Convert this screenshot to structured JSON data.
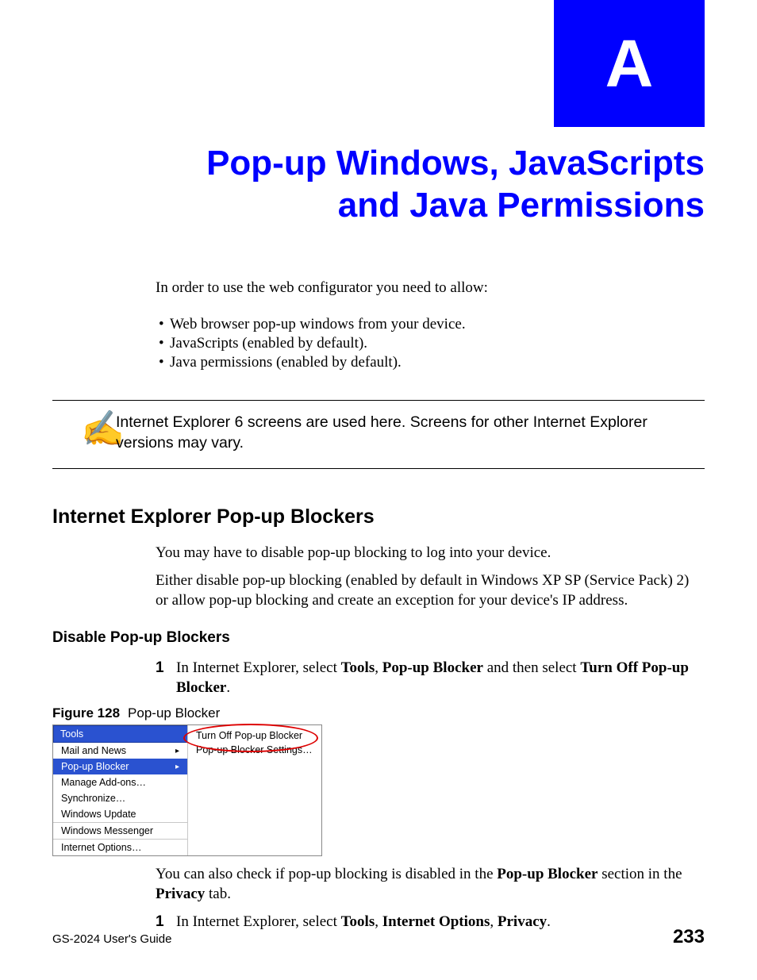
{
  "appendix_letter": "A",
  "chapter_title_line1": "Pop-up Windows, JavaScripts",
  "chapter_title_line2": "and Java Permissions",
  "intro": "In order to use the web configurator you need to allow:",
  "bullets": [
    "Web browser pop-up windows from your device.",
    "JavaScripts (enabled by default).",
    "Java permissions (enabled by default)."
  ],
  "note_icon": "✍",
  "note_text": "Internet Explorer 6 screens are used here. Screens for other Internet Explorer versions may vary.",
  "section_h2": "Internet Explorer Pop-up Blockers",
  "section_p1": "You may have to disable pop-up blocking to log into your device.",
  "section_p2": "Either disable pop-up blocking (enabled by default in Windows XP SP (Service Pack) 2) or allow pop-up blocking and create an exception for your device's IP address.",
  "subsection_h3": "Disable Pop-up Blockers",
  "step1": {
    "num": "1",
    "pre": "In Internet Explorer, select ",
    "b1": "Tools",
    "sep1": ", ",
    "b2": "Pop-up Blocker",
    "mid": " and then select ",
    "b3": "Turn Off Pop-up Blocker",
    "post": "."
  },
  "figure": {
    "label": "Figure 128",
    "caption": "Pop-up Blocker",
    "menu_header": "Tools",
    "menu_items": [
      {
        "label": "Mail and News",
        "chevron": true,
        "hover": false,
        "sep": false
      },
      {
        "label": "Pop-up Blocker",
        "chevron": true,
        "hover": true,
        "sep": false
      },
      {
        "label": "Manage Add-ons…",
        "chevron": false,
        "hover": false,
        "sep": false
      },
      {
        "label": "Synchronize…",
        "chevron": false,
        "hover": false,
        "sep": false
      },
      {
        "label": "Windows Update",
        "chevron": false,
        "hover": false,
        "sep": false
      },
      {
        "label": "Windows Messenger",
        "chevron": false,
        "hover": false,
        "sep": true
      },
      {
        "label": "Internet Options…",
        "chevron": false,
        "hover": false,
        "sep": true
      }
    ],
    "submenu": [
      "Turn Off Pop-up Blocker",
      "Pop-up Blocker Settings…"
    ]
  },
  "after_fig": {
    "pre": "You can also check if pop-up blocking is disabled in the ",
    "b1": "Pop-up Blocker",
    "mid": " section in the ",
    "b2": "Privacy",
    "post": " tab."
  },
  "step2": {
    "num": "1",
    "pre": "In Internet Explorer, select ",
    "b1": "Tools",
    "sep1": ", ",
    "b2": "Internet Options",
    "sep2": ", ",
    "b3": "Privacy",
    "post": "."
  },
  "footer_guide": "GS-2024 User's Guide",
  "footer_page": "233"
}
